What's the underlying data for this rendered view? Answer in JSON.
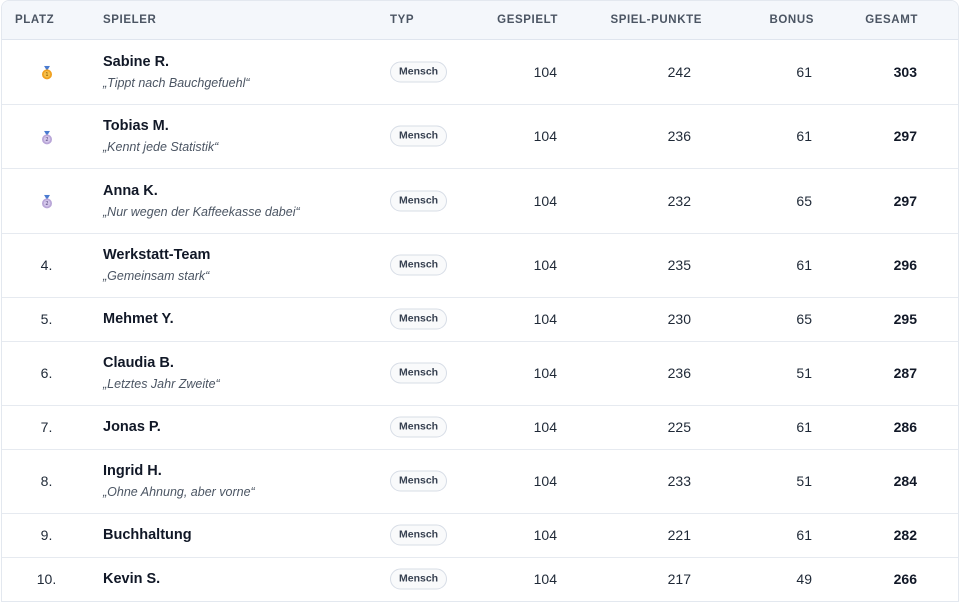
{
  "header": {
    "rank": "PLATZ",
    "player": "SPIELER",
    "type": "TYP",
    "played": "GESPIELT",
    "points": "SPIEL-PUNKTE",
    "bonus": "BONUS",
    "total": "GESAMT"
  },
  "colors": {
    "medal_gold": "#f0a020",
    "medal_silver": "#b9a6d8"
  },
  "rows": [
    {
      "rank": "",
      "medal": "gold-medal-icon",
      "name": "Sabine R.",
      "motto": "„Tippt nach Bauchgefuehl“",
      "type": "Mensch",
      "played": "104",
      "points": "242",
      "bonus": "61",
      "total": "303"
    },
    {
      "rank": "",
      "medal": "silver-medal-icon",
      "name": "Tobias M.",
      "motto": "„Kennt jede Statistik“",
      "type": "Mensch",
      "played": "104",
      "points": "236",
      "bonus": "61",
      "total": "297"
    },
    {
      "rank": "",
      "medal": "silver-medal-icon",
      "name": "Anna K.",
      "motto": "„Nur wegen der Kaffeekasse dabei“",
      "type": "Mensch",
      "played": "104",
      "points": "232",
      "bonus": "65",
      "total": "297"
    },
    {
      "rank": "4.",
      "name": "Werkstatt-Team",
      "motto": "„Gemeinsam stark“",
      "type": "Mensch",
      "played": "104",
      "points": "235",
      "bonus": "61",
      "total": "296"
    },
    {
      "rank": "5.",
      "name": "Mehmet Y.",
      "motto": "",
      "type": "Mensch",
      "played": "104",
      "points": "230",
      "bonus": "65",
      "total": "295"
    },
    {
      "rank": "6.",
      "name": "Claudia B.",
      "motto": "„Letztes Jahr Zweite“",
      "type": "Mensch",
      "played": "104",
      "points": "236",
      "bonus": "51",
      "total": "287"
    },
    {
      "rank": "7.",
      "name": "Jonas P.",
      "motto": "",
      "type": "Mensch",
      "played": "104",
      "points": "225",
      "bonus": "61",
      "total": "286"
    },
    {
      "rank": "8.",
      "name": "Ingrid H.",
      "motto": "„Ohne Ahnung, aber vorne“",
      "type": "Mensch",
      "played": "104",
      "points": "233",
      "bonus": "51",
      "total": "284"
    },
    {
      "rank": "9.",
      "name": "Buchhaltung",
      "motto": "",
      "type": "Mensch",
      "played": "104",
      "points": "221",
      "bonus": "61",
      "total": "282"
    },
    {
      "rank": "10.",
      "name": "Kevin S.",
      "motto": "",
      "type": "Mensch",
      "played": "104",
      "points": "217",
      "bonus": "49",
      "total": "266"
    }
  ]
}
